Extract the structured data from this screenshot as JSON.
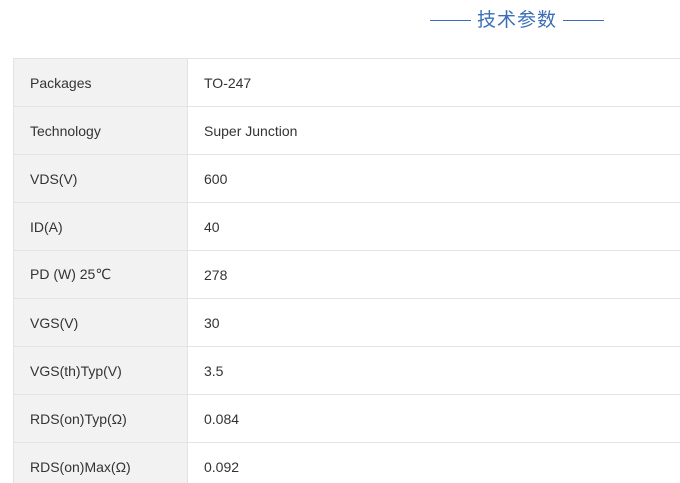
{
  "section": {
    "title": "技术参数"
  },
  "specs": [
    {
      "label": "Packages",
      "value": "TO-247"
    },
    {
      "label": "Technology",
      "value": "Super Junction"
    },
    {
      "label": "VDS(V)",
      "value": "600"
    },
    {
      "label": "ID(A)",
      "value": "40"
    },
    {
      "label": "PD (W) 25℃",
      "value": "278"
    },
    {
      "label": "VGS(V)",
      "value": "30"
    },
    {
      "label": "VGS(th)Typ(V)",
      "value": "3.5"
    },
    {
      "label": "RDS(on)Typ(Ω)",
      "value": "0.084"
    },
    {
      "label": "RDS(on)Max(Ω)",
      "value": "0.092"
    }
  ]
}
